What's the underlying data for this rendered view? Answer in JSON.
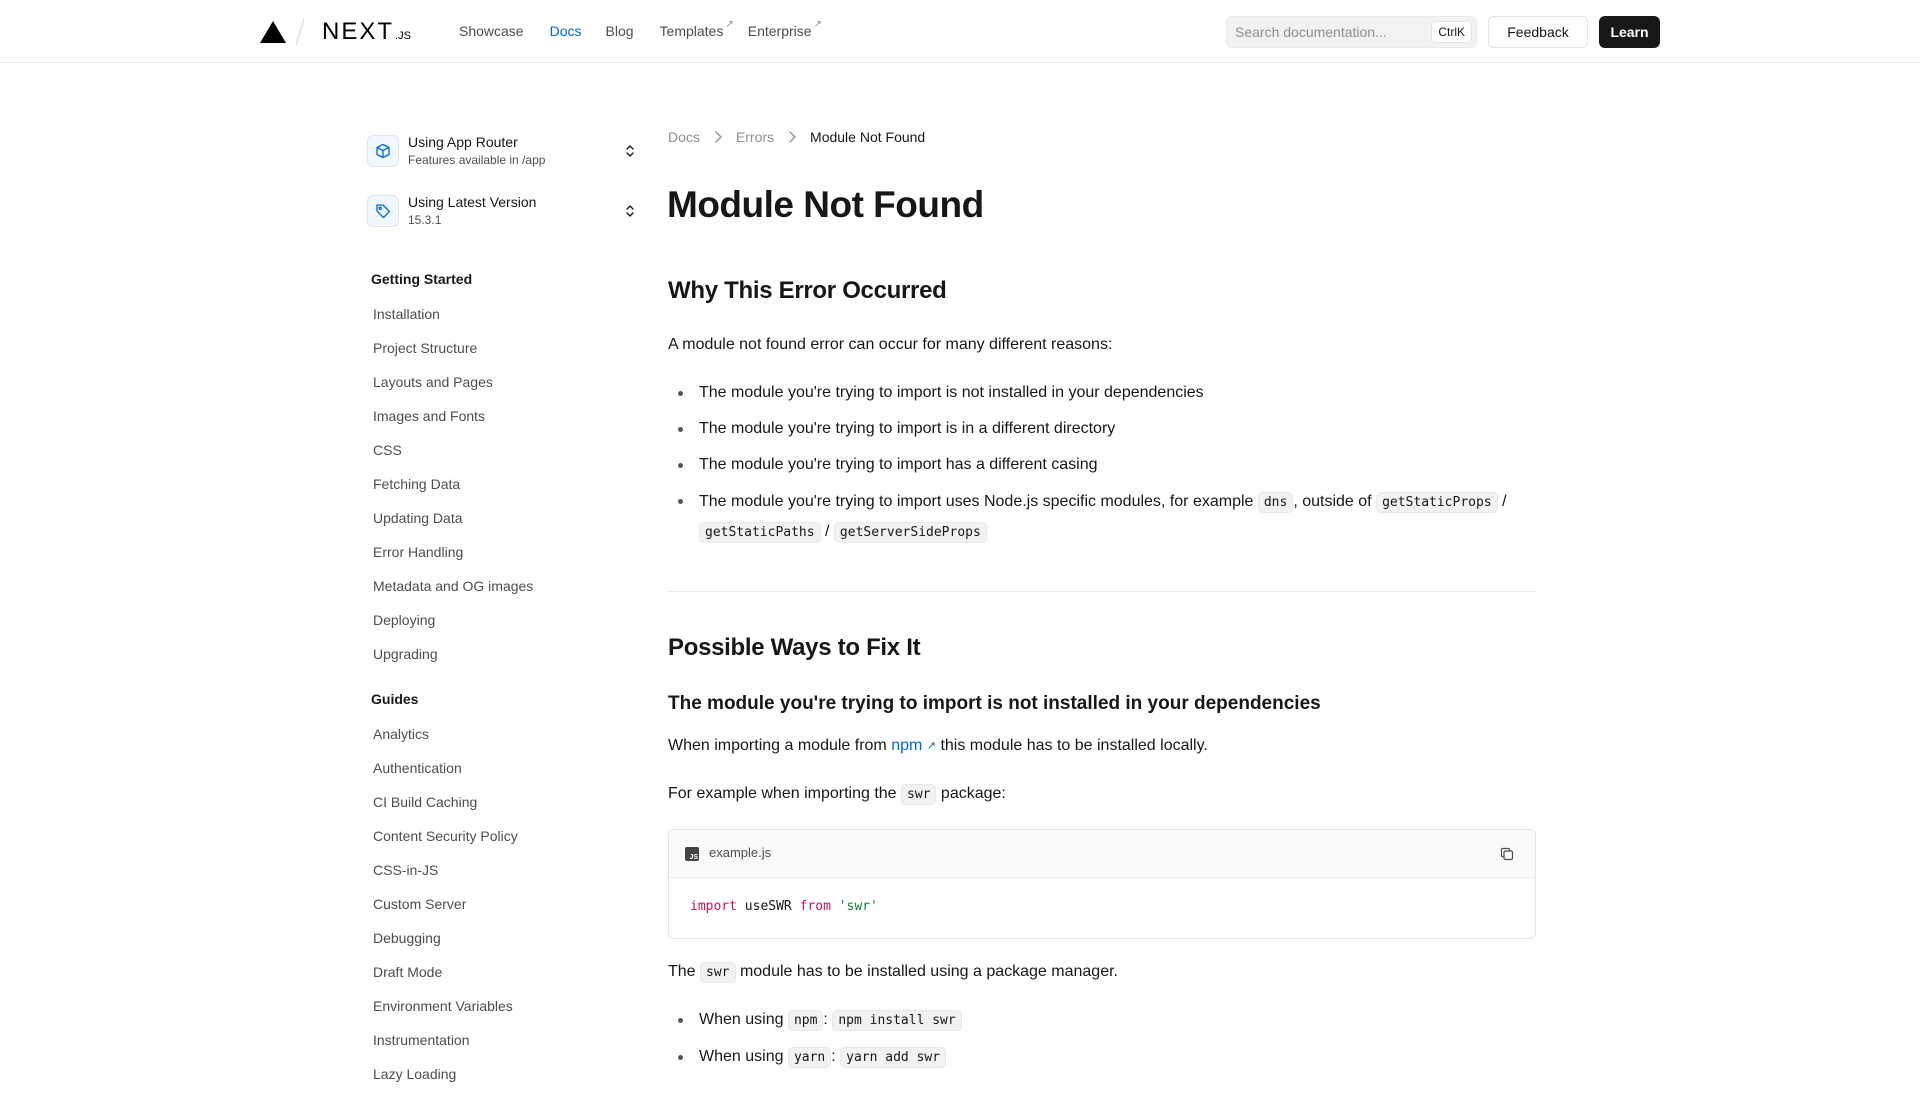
{
  "nav": {
    "logo_text": "NEXT",
    "logo_suffix": ".JS",
    "links": [
      {
        "label": "Showcase"
      },
      {
        "label": "Docs"
      },
      {
        "label": "Blog"
      },
      {
        "label": "Templates",
        "external": "↗"
      },
      {
        "label": "Enterprise",
        "external": "↗"
      }
    ],
    "search_placeholder": "Search documentation...",
    "search_shortcut": "CtrlK",
    "feedback_label": "Feedback",
    "learn_label": "Learn"
  },
  "sidebar": {
    "router_switcher": {
      "title": "Using App Router",
      "subtitle": "Features available in /app",
      "icon": "cube-icon"
    },
    "version_switcher": {
      "title": "Using Latest Version",
      "subtitle": "15.3.1",
      "icon": "tag-icon"
    },
    "sections": [
      {
        "title": "Getting Started",
        "items": [
          "Installation",
          "Project Structure",
          "Layouts and Pages",
          "Images and Fonts",
          "CSS",
          "Fetching Data",
          "Updating Data",
          "Error Handling",
          "Metadata and OG images",
          "Deploying",
          "Upgrading"
        ]
      },
      {
        "title": "Guides",
        "items": [
          "Analytics",
          "Authentication",
          "CI Build Caching",
          "Content Security Policy",
          "CSS-in-JS",
          "Custom Server",
          "Debugging",
          "Draft Mode",
          "Environment Variables",
          "Instrumentation",
          "Lazy Loading"
        ]
      }
    ]
  },
  "breadcrumb": [
    "Docs",
    "Errors",
    "Module Not Found"
  ],
  "content": {
    "title": "Module Not Found",
    "why": {
      "heading": "Why This Error Occurred",
      "intro": "A module not found error can occur for many different reasons:",
      "reasons": [
        "The module you're trying to import is not installed in your dependencies",
        "The module you're trying to import is in a different directory",
        "The module you're trying to import has a different casing"
      ],
      "reason4": {
        "text_a": "The module you're trying to import uses Node.js specific modules, for example ",
        "code_a": "dns",
        "text_b": ", outside of ",
        "code_b": "getStaticProps",
        "sep1": " / ",
        "code_c": "getStaticPaths",
        "sep2": " / ",
        "code_d": "getServerSideProps"
      }
    },
    "fix": {
      "heading": "Possible Ways to Fix It",
      "subheading": "The module you're trying to import is not installed in your dependencies",
      "p1_a": "When importing a module from ",
      "p1_link": "npm",
      "p1_link_icon": "↗",
      "p1_b": " this module has to be installed locally.",
      "p2_a": "For example when importing the ",
      "p2_code": "swr",
      "p2_b": " package:",
      "code_filename": "example.js",
      "code_kw_import": "import",
      "code_ident": " useSWR ",
      "code_kw_from": "from",
      "code_str": " 'swr'",
      "p3_a": "The ",
      "p3_code": "swr",
      "p3_b": " module has to be installed using a package manager.",
      "pm": [
        {
          "prefix": "When using ",
          "manager": "npm",
          "colon": ": ",
          "command": "npm install swr"
        },
        {
          "prefix": "When using ",
          "manager": "yarn",
          "colon": ": ",
          "command": "yarn add swr"
        }
      ]
    }
  }
}
